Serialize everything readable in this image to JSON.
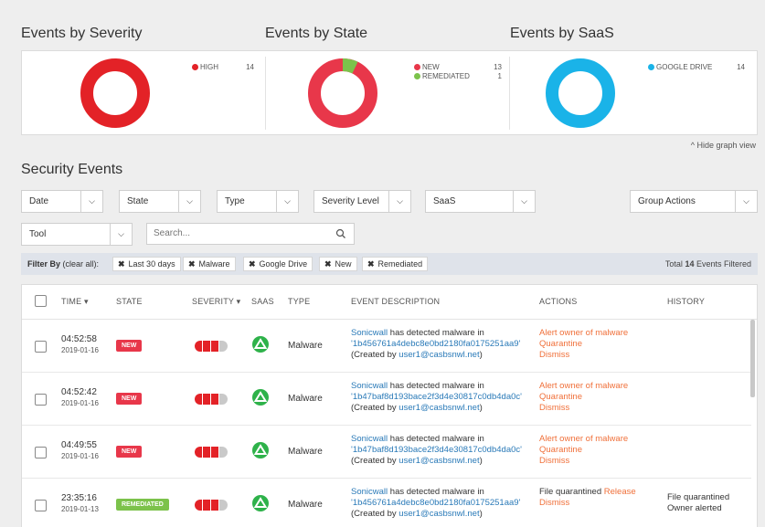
{
  "charts": [
    {
      "title": "Events by Severity",
      "legend": [
        {
          "label": "HIGH",
          "value": "14",
          "color": "#e32227"
        }
      ]
    },
    {
      "title": "Events by State",
      "legend": [
        {
          "label": "NEW",
          "value": "13",
          "color": "#e8374a"
        },
        {
          "label": "REMEDIATED",
          "value": "1",
          "color": "#7cc24b"
        }
      ]
    },
    {
      "title": "Events by SaaS",
      "legend": [
        {
          "label": "GOOGLE DRIVE",
          "value": "14",
          "color": "#1ab3e8"
        }
      ]
    }
  ],
  "hide_graph_label": "^ Hide graph view",
  "section_title": "Security Events",
  "filters": {
    "date": "Date",
    "state": "State",
    "type": "Type",
    "severity": "Severity Level",
    "saas": "SaaS",
    "group_actions": "Group Actions",
    "tool": "Tool",
    "search_placeholder": "Search..."
  },
  "filter_bar": {
    "label_prefix": "Filter By",
    "clear_all": "(clear all):",
    "chips": [
      "Last 30 days",
      "Malware",
      "Google Drive",
      "New",
      "Remediated"
    ],
    "total_prefix": "Total",
    "total_count": "14",
    "total_suffix": "Events Filtered"
  },
  "table": {
    "headers": {
      "time": "TIME ▾",
      "state": "STATE",
      "severity": "SEVERITY ▾",
      "saas": "SAAS",
      "type": "TYPE",
      "description": "EVENT DESCRIPTION",
      "actions": "ACTIONS",
      "history": "HISTORY"
    },
    "rows": [
      {
        "time": "04:52:58",
        "date": "2019-01-16",
        "state": "NEW",
        "type": "Malware",
        "desc_vendor": "Sonicwall",
        "desc_text": " has detected malware in",
        "desc_file": "'1b456761a4debc8e0bd2180fa0175251aa9'",
        "desc_by": "(Created by ",
        "desc_user": "user1@casbsnwl.net",
        "desc_end": ")",
        "actions": [
          "Alert owner of malware",
          "Quarantine",
          "Dismiss"
        ]
      },
      {
        "time": "04:52:42",
        "date": "2019-01-16",
        "state": "NEW",
        "type": "Malware",
        "desc_vendor": "Sonicwall",
        "desc_text": " has detected malware in",
        "desc_file": "'1b47baf8d193bace2f3d4e30817c0db4da0c'",
        "desc_by": "(Created by ",
        "desc_user": "user1@casbsnwl.net",
        "desc_end": ")",
        "actions": [
          "Alert owner of malware",
          "Quarantine",
          "Dismiss"
        ]
      },
      {
        "time": "04:49:55",
        "date": "2019-01-16",
        "state": "NEW",
        "type": "Malware",
        "desc_vendor": "Sonicwall",
        "desc_text": " has detected malware in",
        "desc_file": "'1b47baf8d193bace2f3d4e30817c0db4da0c'",
        "desc_by": "(Created by ",
        "desc_user": "user1@casbsnwl.net",
        "desc_end": ")",
        "actions": [
          "Alert owner of malware",
          "Quarantine",
          "Dismiss"
        ]
      },
      {
        "time": "23:35:16",
        "date": "2019-01-13",
        "state": "REMEDIATED",
        "type": "Malware",
        "desc_vendor": "Sonicwall",
        "desc_text": " has detected malware in",
        "desc_file": "'1b456761a4debc8e0bd2180fa0175251aa9'",
        "desc_by": "(Created by ",
        "desc_user": "user1@casbsnwl.net",
        "desc_end": ")",
        "action_status": "File quarantined ",
        "action_release": "Release",
        "action_dismiss": "Dismiss",
        "history": [
          "File quarantined",
          "Owner alerted"
        ]
      }
    ]
  },
  "colors": {
    "new_badge": "#e8374a",
    "remediated_badge": "#7cc24b",
    "severity_red": "#e32227",
    "saas_green": "#2eb24a",
    "link": "#2a7ab8",
    "action": "#f0703a"
  }
}
